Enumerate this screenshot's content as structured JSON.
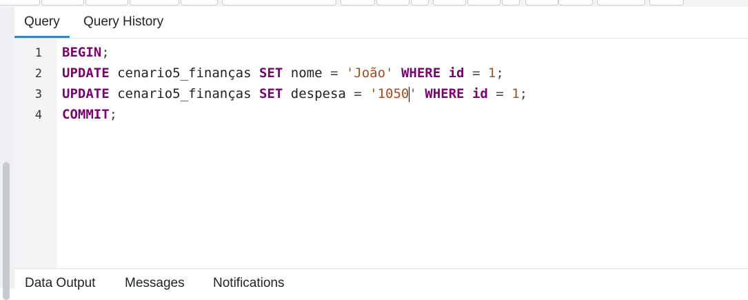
{
  "tabs": [
    {
      "label": "Query",
      "active": true
    },
    {
      "label": "Query History",
      "active": false
    }
  ],
  "editor": {
    "line_numbers": [
      "1",
      "2",
      "3",
      "4"
    ],
    "lines": [
      [
        {
          "t": "kw",
          "v": "BEGIN"
        },
        {
          "t": "op",
          "v": ";"
        }
      ],
      [
        {
          "t": "kw",
          "v": "UPDATE"
        },
        {
          "t": "id",
          "v": " cenario5_finanças "
        },
        {
          "t": "kw",
          "v": "SET"
        },
        {
          "t": "id",
          "v": " nome "
        },
        {
          "t": "op",
          "v": "="
        },
        {
          "t": "id",
          "v": " "
        },
        {
          "t": "str",
          "v": "'João'"
        },
        {
          "t": "id",
          "v": " "
        },
        {
          "t": "kw",
          "v": "WHERE"
        },
        {
          "t": "id",
          "v": " "
        },
        {
          "t": "kw",
          "v": "id"
        },
        {
          "t": "id",
          "v": " "
        },
        {
          "t": "op",
          "v": "="
        },
        {
          "t": "id",
          "v": " "
        },
        {
          "t": "num",
          "v": "1"
        },
        {
          "t": "op",
          "v": ";"
        }
      ],
      [
        {
          "t": "kw",
          "v": "UPDATE"
        },
        {
          "t": "id",
          "v": " cenario5_finanças "
        },
        {
          "t": "kw",
          "v": "SET"
        },
        {
          "t": "id",
          "v": " despesa "
        },
        {
          "t": "op",
          "v": "="
        },
        {
          "t": "id",
          "v": " "
        },
        {
          "t": "str",
          "v": "'1050"
        },
        {
          "t": "cursor",
          "v": ""
        },
        {
          "t": "str",
          "v": "'"
        },
        {
          "t": "id",
          "v": " "
        },
        {
          "t": "kw",
          "v": "WHERE"
        },
        {
          "t": "id",
          "v": " "
        },
        {
          "t": "kw",
          "v": "id"
        },
        {
          "t": "id",
          "v": " "
        },
        {
          "t": "op",
          "v": "="
        },
        {
          "t": "id",
          "v": " "
        },
        {
          "t": "num",
          "v": "1"
        },
        {
          "t": "op",
          "v": ";"
        }
      ],
      [
        {
          "t": "kw",
          "v": "COMMIT"
        },
        {
          "t": "op",
          "v": ";"
        }
      ]
    ]
  },
  "output_tabs": [
    "Data Output",
    "Messages",
    "Notifications"
  ],
  "colors": {
    "keyword": "#7a0070",
    "string": "#a24a20",
    "number": "#8a5a2a",
    "active_tab_underline": "#3b82c4"
  }
}
